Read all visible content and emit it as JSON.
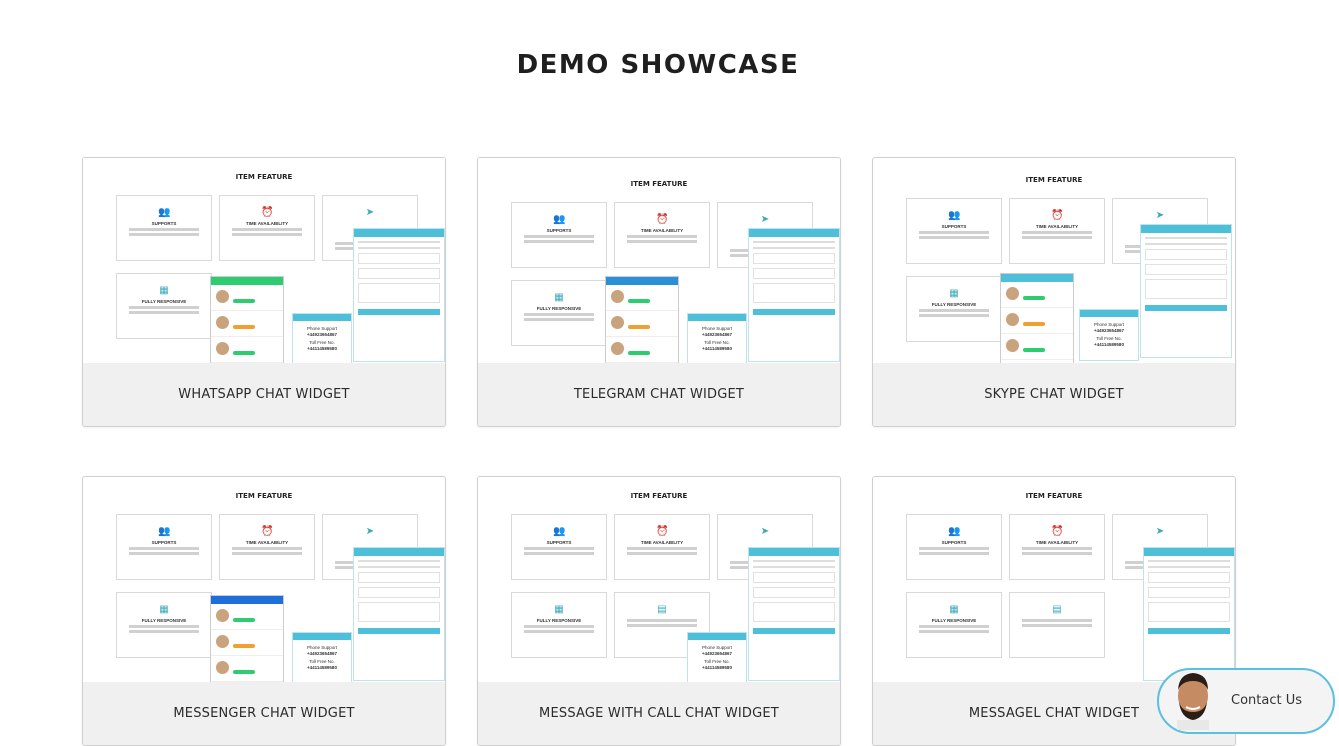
{
  "page": {
    "title": "DEMO SHOWCASE"
  },
  "cards": [
    {
      "caption": "WHATSAPP CHAT WIDGET",
      "accent": "#2ecc71"
    },
    {
      "caption": "TELEGRAM CHAT WIDGET",
      "accent": "#2a8fd6"
    },
    {
      "caption": "SKYPE CHAT WIDGET",
      "accent": "#4dbfd9"
    },
    {
      "caption": "MESSENGER CHAT WIDGET",
      "accent": "#1e6fd9"
    },
    {
      "caption": "MESSAGE WITH CALL CHAT WIDGET",
      "accent": "#4dbfd9"
    },
    {
      "caption": "MESSAGEL CHAT WIDGET",
      "accent": "#4dbfd9"
    }
  ],
  "preview": {
    "heading": "ITEM FEATURE",
    "box_titles": [
      "SUPPORTS",
      "TIME AVAILABILITY",
      "FULLY RESPONSIVE"
    ],
    "call_lines": [
      "Phone Support",
      "+44923654867",
      "Toll Free No.",
      "+44114589580"
    ]
  },
  "contact": {
    "label": "Contact Us",
    "color": "#5bc0de"
  }
}
